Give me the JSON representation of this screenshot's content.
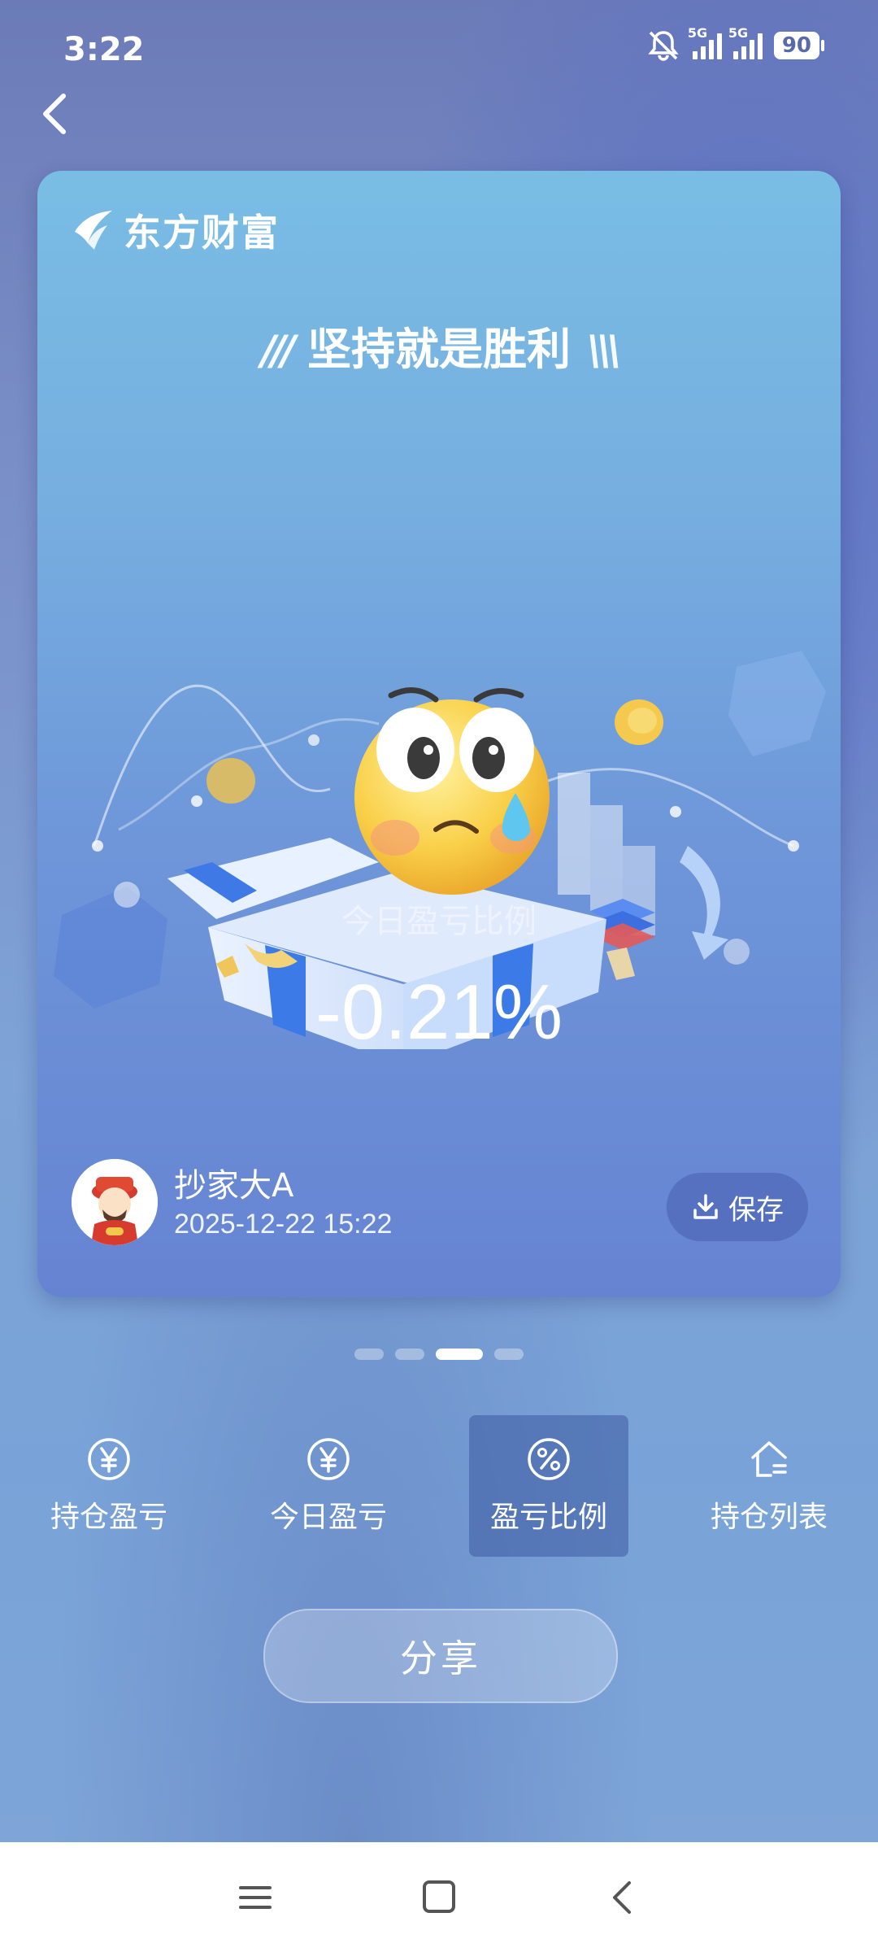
{
  "status": {
    "time": "3:22",
    "battery": "90",
    "signal1": "5G",
    "signal2": "5G"
  },
  "card": {
    "brand": "东方财富",
    "slogan": "坚持就是胜利",
    "ratio_label": "今日盈亏比例",
    "ratio_value": "-0.21%",
    "user_name": "抄家大A",
    "datetime": "2025-12-22 15:22",
    "save_label": "保存"
  },
  "pager": {
    "count": 4,
    "active": 2
  },
  "tabs": [
    {
      "label": "持仓盈亏",
      "icon": "yen-circle-icon",
      "active": false
    },
    {
      "label": "今日盈亏",
      "icon": "yen-circle-icon",
      "active": false
    },
    {
      "label": "盈亏比例",
      "icon": "percent-circle-icon",
      "active": true
    },
    {
      "label": "持仓列表",
      "icon": "house-list-icon",
      "active": false
    }
  ],
  "share_label": "分享",
  "colors": {
    "card_top": "#79bde4",
    "card_bottom": "#6683d2",
    "active_tab": "#4a64a8"
  }
}
